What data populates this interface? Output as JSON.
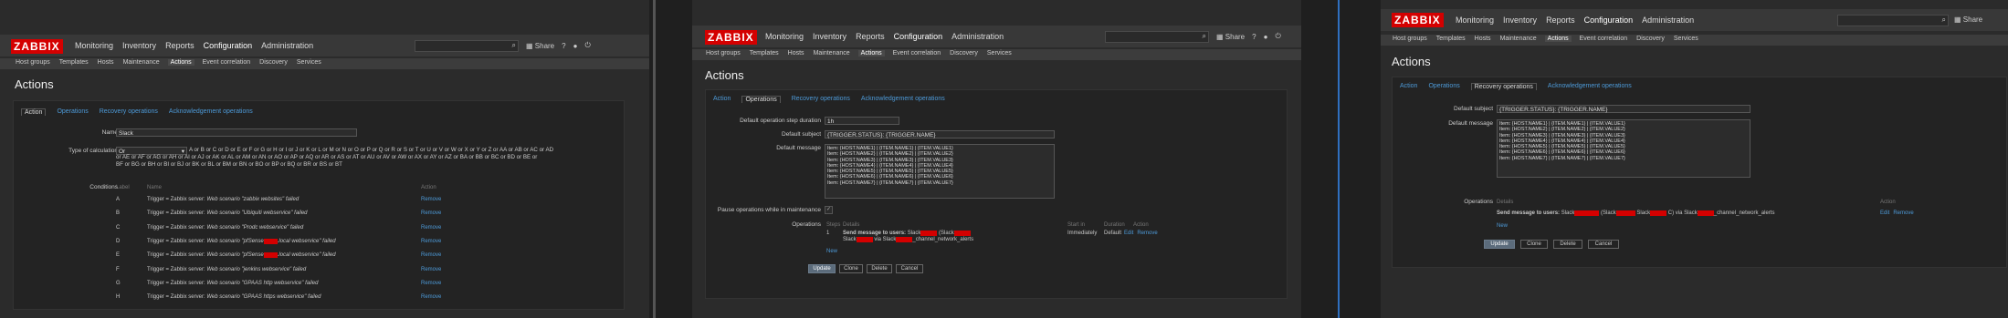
{
  "app": {
    "logo": "ZABBIX",
    "menu": [
      "Monitoring",
      "Inventory",
      "Reports",
      "Configuration",
      "Administration"
    ],
    "submenu": [
      "Host groups",
      "Templates",
      "Hosts",
      "Maintenance",
      "Actions",
      "Event correlation",
      "Discovery",
      "Services"
    ],
    "share_label": "Share",
    "help_icon": "?",
    "page_title": "Actions",
    "icons": {
      "search": "search-icon",
      "share": "share-icon",
      "help": "help-icon",
      "user": "user-icon",
      "power": "power-icon"
    }
  },
  "panel1": {
    "tabs": [
      "Action",
      "Operations",
      "Recovery operations",
      "Acknowledgement operations"
    ],
    "name_label": "Name",
    "name_value": "Slack",
    "calc_label": "Type of calculation",
    "calc_select": "Or",
    "calc_expression_lines": [
      "A or B or C or D or E or F or G or H or I or J or K or L or M or N or O or P or Q or R or S or T or U or V or W or X or Y or Z or AA or AB or AC or AD",
      "or AE or AF or AG or AH or AI or AJ or AK or AL or AM or AN or AO or AP or AQ or AR or AS or AT or AU or AV or AW or AX or AY or AZ or BA or BB or BC or BD or BE or",
      "BF or BG or BH or BI or BJ or BK or BL or BM or BN or BO or BP or BQ or BR or BS or BT"
    ],
    "conditions_label": "Conditions",
    "cond_headers": {
      "label": "Label",
      "name": "Name",
      "action": "Action"
    },
    "conditions": [
      {
        "label": "A",
        "prefix": "Trigger = Zabbix server: ",
        "text": "Web scenario \"zabbix websites\" failed",
        "remove": "Remove"
      },
      {
        "label": "B",
        "prefix": "Trigger = Zabbix server: ",
        "text": "Web scenario \"Ubiquiti webservice\" failed",
        "remove": "Remove"
      },
      {
        "label": "C",
        "prefix": "Trigger = Zabbix server: ",
        "text": "Web scenario \"Prodc webservice\" failed",
        "remove": "Remove"
      },
      {
        "label": "D",
        "prefix": "Trigger = Zabbix server: ",
        "text": "Web scenario \"pfSense",
        "text2": ".local webservice\" failed",
        "remove": "Remove"
      },
      {
        "label": "E",
        "prefix": "Trigger = Zabbix server: ",
        "text": "Web scenario \"pfSense",
        "text2": ".local webservice\" failed",
        "remove": "Remove"
      },
      {
        "label": "F",
        "prefix": "Trigger = Zabbix server: ",
        "text": "Web scenario \"jenkins webservice\" failed",
        "remove": "Remove"
      },
      {
        "label": "G",
        "prefix": "Trigger = Zabbix server: ",
        "text": "Web scenario \"GPAAS http webservice\" failed",
        "remove": "Remove"
      },
      {
        "label": "H",
        "prefix": "Trigger = Zabbix server: ",
        "text": "Web scenario \"GPAAS https webservice\" failed",
        "remove": "Remove"
      }
    ]
  },
  "panel2": {
    "tabs": [
      "Action",
      "Operations",
      "Recovery operations",
      "Acknowledgement operations"
    ],
    "step_label": "Default operation step duration",
    "step_value": "1h",
    "subject_label": "Default subject",
    "subject_value": "{TRIGGER.STATUS}: {TRIGGER.NAME}",
    "message_label": "Default message",
    "message_lines": [
      "Item: {HOST.NAME1} | {ITEM.NAME1} | {ITEM.VALUE1}",
      "Item: {HOST.NAME2} | {ITEM.NAME2} | {ITEM.VALUE2}",
      "Item: {HOST.NAME3} | {ITEM.NAME3} | {ITEM.VALUE3}",
      "Item: {HOST.NAME4} | {ITEM.NAME4} | {ITEM.VALUE4}",
      "Item: {HOST.NAME5} | {ITEM.NAME5} | {ITEM.VALUE5}",
      "Item: {HOST.NAME6} | {ITEM.NAME6} | {ITEM.VALUE6}",
      "Item: {HOST.NAME7} | {ITEM.NAME7} | {ITEM.VALUE7}"
    ],
    "pause_label": "Pause operations while in maintenance",
    "operations_label": "Operations",
    "op_headers": {
      "steps": "Steps",
      "details": "Details",
      "start": "Start in",
      "duration": "Duration",
      "action": "Action"
    },
    "op_step": "1",
    "op_send": "Send message to users:",
    "op_text1": "Slack",
    "op_text2": "(Slack",
    "op_text3": "Slack",
    "op_text4": "via Slack",
    "op_text5": "_channel_network_alerts",
    "op_start": "Immediately",
    "op_duration": "Default",
    "op_edit": "Edit",
    "op_remove": "Remove",
    "new_link": "New",
    "buttons": [
      "Update",
      "Clone",
      "Delete",
      "Cancel"
    ]
  },
  "panel3": {
    "tabs": [
      "Action",
      "Operations",
      "Recovery operations",
      "Acknowledgement operations"
    ],
    "subject_label": "Default subject",
    "subject_value": "{TRIGGER.STATUS}: {TRIGGER.NAME}",
    "message_label": "Default message",
    "message_lines": [
      "Item: {HOST.NAME1} | {ITEM.NAME1} | {ITEM.VALUE1}",
      "Item: {HOST.NAME2} | {ITEM.NAME2} | {ITEM.VALUE2}",
      "Item: {HOST.NAME3} | {ITEM.NAME3} | {ITEM.VALUE3}",
      "Item: {HOST.NAME4} | {ITEM.NAME4} | {ITEM.VALUE4}",
      "Item: {HOST.NAME5} | {ITEM.NAME5} | {ITEM.VALUE5}",
      "Item: {HOST.NAME6} | {ITEM.NAME6} | {ITEM.VALUE6}",
      "Item: {HOST.NAME7} | {ITEM.NAME7} | {ITEM.VALUE7}"
    ],
    "operations_label": "Operations",
    "op_headers": {
      "details": "Details",
      "action": "Action"
    },
    "op_send": "Send message to users:",
    "op_text1": "Slack",
    "op_text2": "(Slack",
    "op_text3": "Slack",
    "op_text4": "C) via Slack",
    "op_text5": "_channel_network_alerts",
    "op_edit": "Edit",
    "op_remove": "Remove",
    "new_link": "New",
    "buttons": [
      "Update",
      "Clone",
      "Delete",
      "Cancel"
    ]
  },
  "colors": {
    "brand": "#d40000",
    "link": "#4d9ad8",
    "background": "#2b2b2b"
  }
}
